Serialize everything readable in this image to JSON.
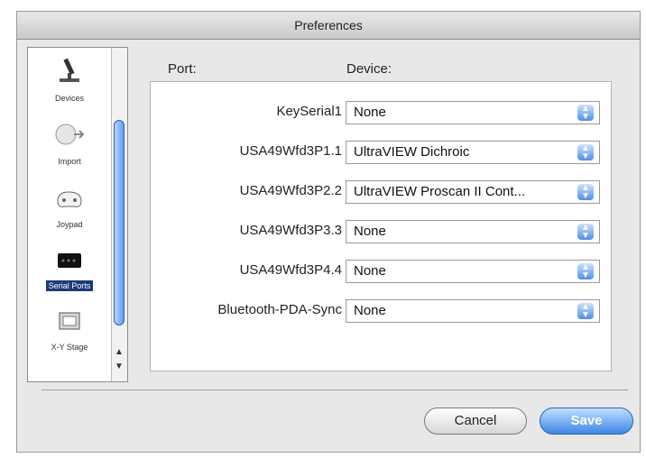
{
  "window": {
    "title": "Preferences"
  },
  "sidebar": {
    "items": [
      {
        "label": "Devices",
        "icon": "microscope-icon"
      },
      {
        "label": "Import",
        "icon": "import-icon"
      },
      {
        "label": "Joypad",
        "icon": "joypad-icon"
      },
      {
        "label": "Serial Ports",
        "icon": "serial-port-icon",
        "selected": true
      },
      {
        "label": "X-Y Stage",
        "icon": "xy-stage-icon"
      }
    ]
  },
  "headers": {
    "port": "Port:",
    "device": "Device:"
  },
  "ports": [
    {
      "port": "KeySerial1",
      "device": "None"
    },
    {
      "port": "USA49Wfd3P1.1",
      "device": "UltraVIEW Dichroic"
    },
    {
      "port": "USA49Wfd3P2.2",
      "device": "UltraVIEW Proscan II Cont..."
    },
    {
      "port": "USA49Wfd3P3.3",
      "device": "None"
    },
    {
      "port": "USA49Wfd3P4.4",
      "device": "None"
    },
    {
      "port": "Bluetooth-PDA-Sync",
      "device": "None"
    }
  ],
  "buttons": {
    "cancel": "Cancel",
    "save": "Save"
  },
  "colors": {
    "accent": "#3e86e6",
    "selected": "#1b3a78"
  }
}
